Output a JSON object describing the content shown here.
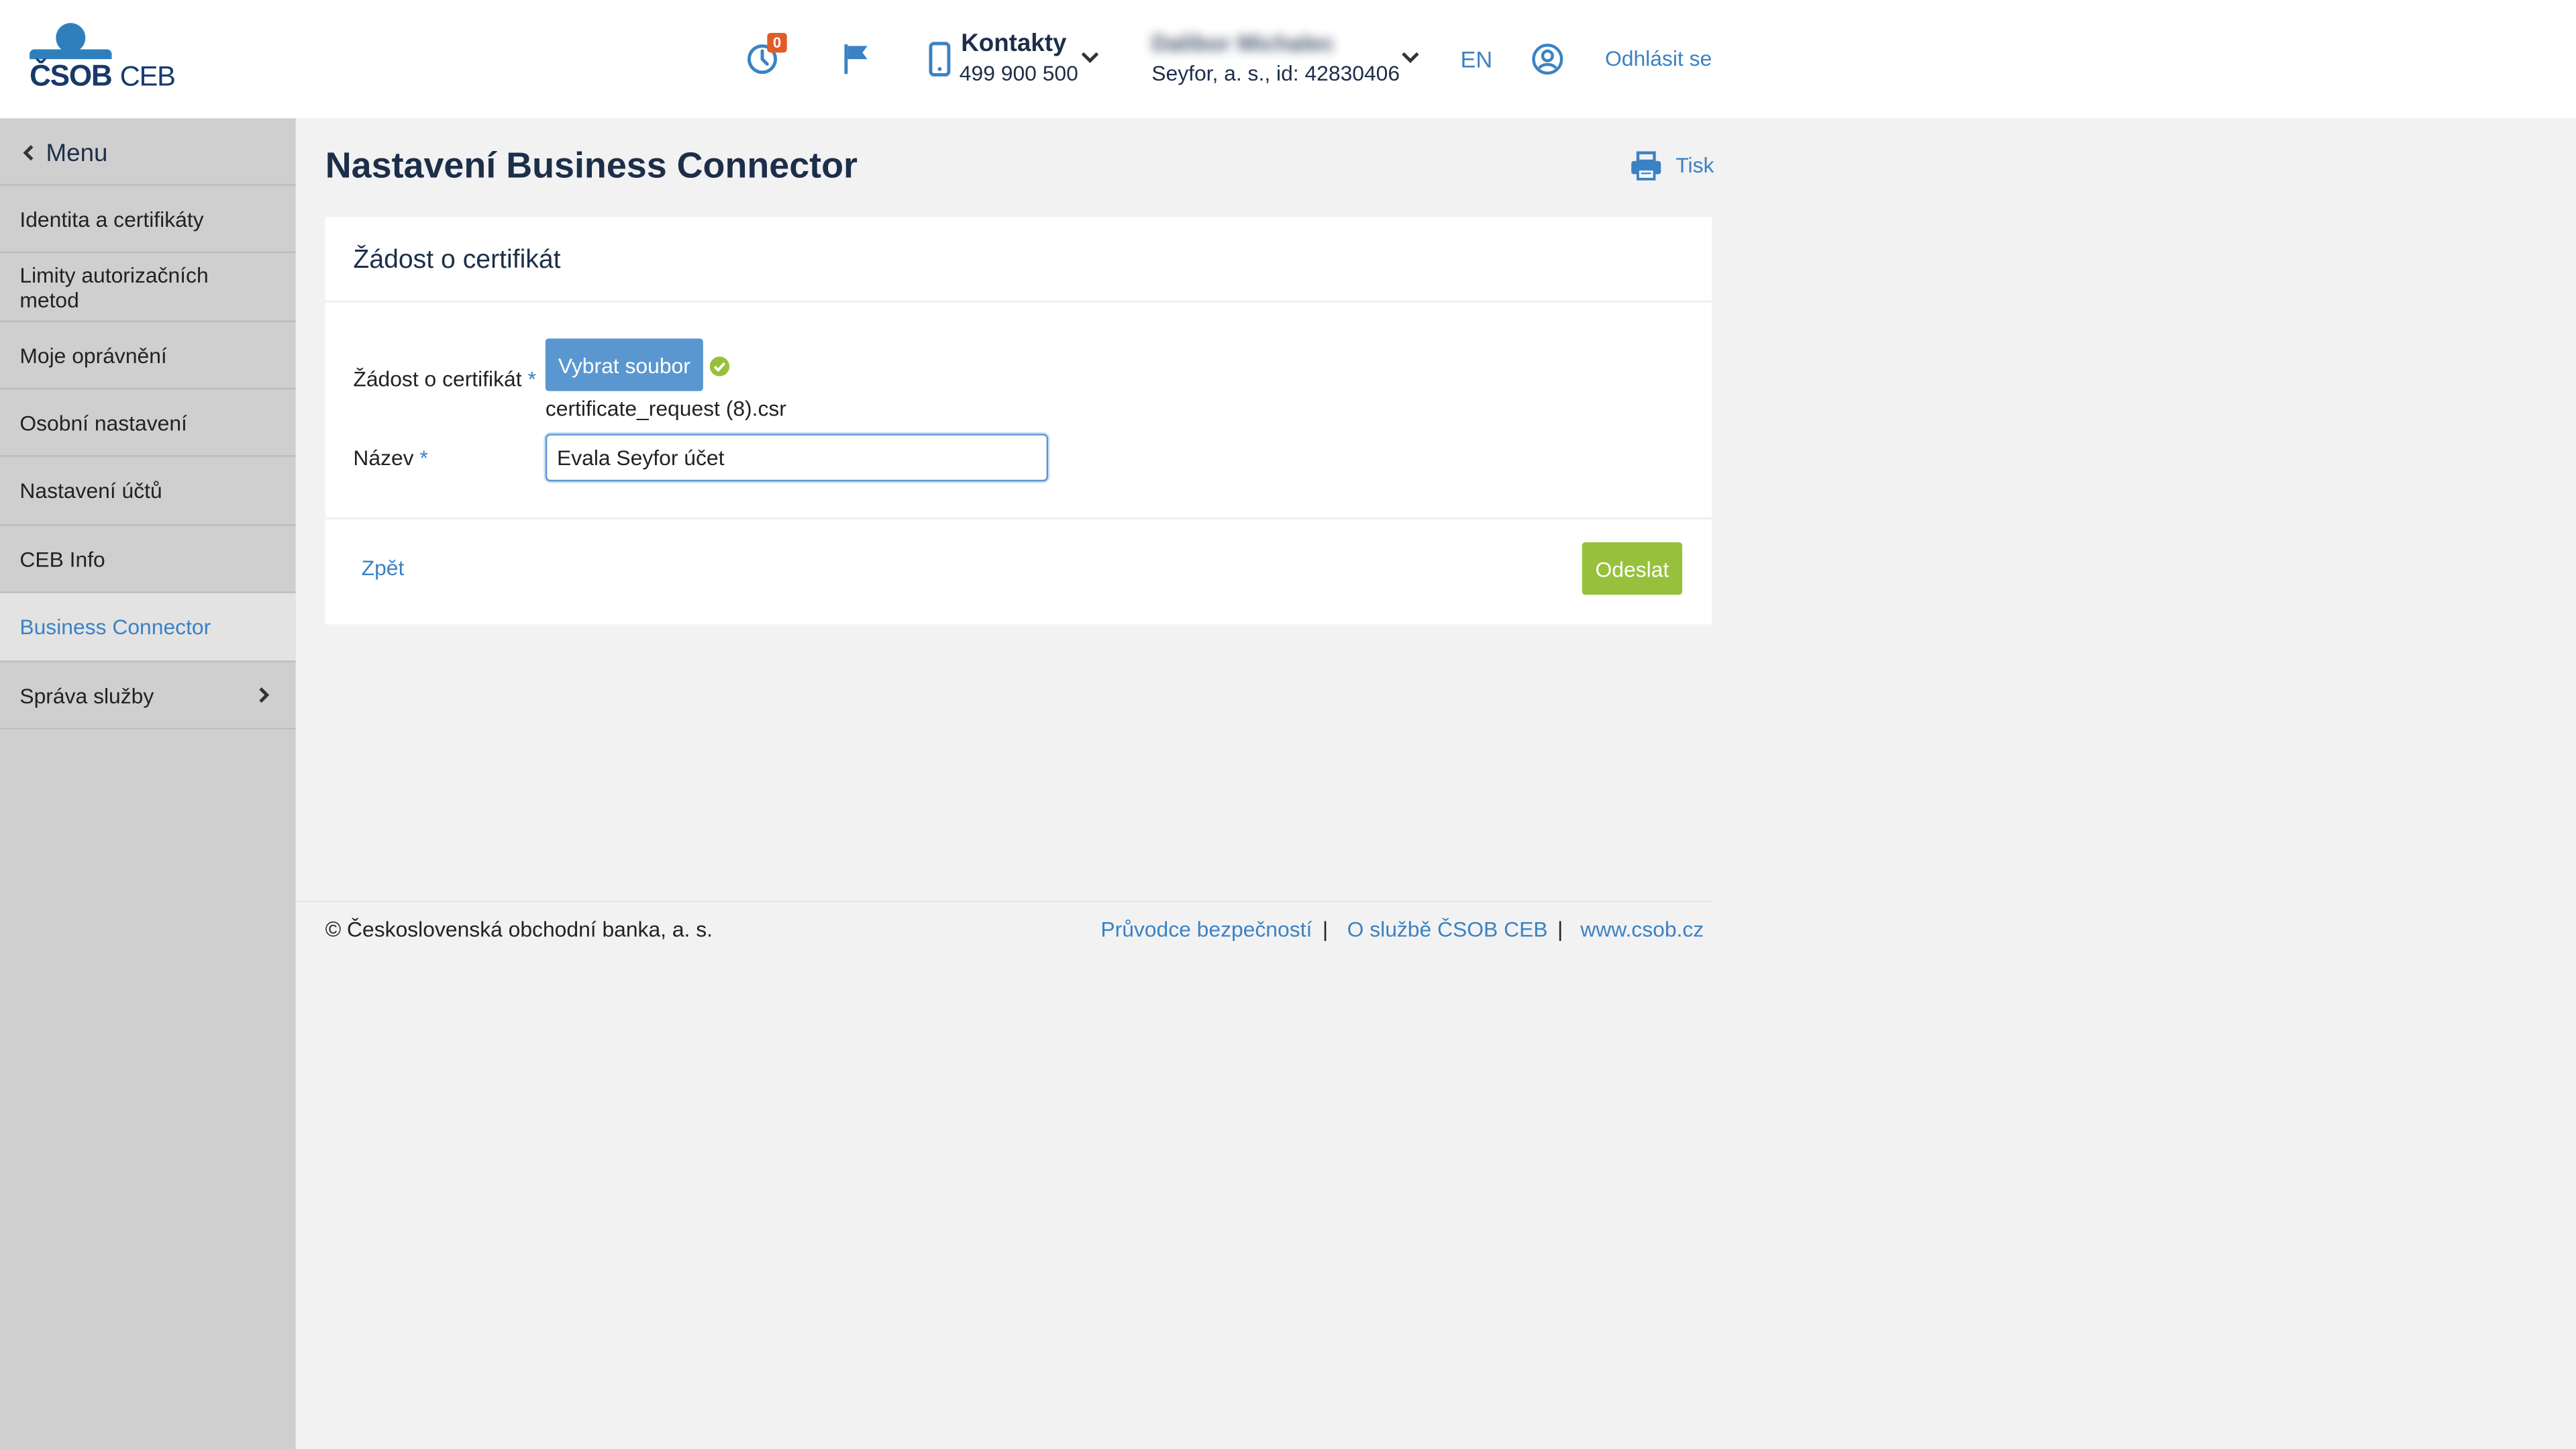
{
  "header": {
    "logo_text": "ČSOB",
    "logo_suffix": "CEB",
    "notification_count": "0",
    "contacts_title": "Kontakty",
    "contacts_phone": "499 900 500",
    "user_name": "Dalibor Michalec",
    "user_company": "Seyfor, a. s., id: 42830406",
    "language": "EN",
    "logout": "Odhlásit se"
  },
  "sidebar": {
    "menu_label": "Menu",
    "items": [
      {
        "label": "Identita a certifikáty"
      },
      {
        "label": "Limity autorizačních metod"
      },
      {
        "label": "Moje oprávnění"
      },
      {
        "label": "Osobní nastavení"
      },
      {
        "label": "Nastavení účtů"
      },
      {
        "label": "CEB Info"
      },
      {
        "label": "Business Connector",
        "active": true
      },
      {
        "label": "Správa služby"
      }
    ]
  },
  "main": {
    "title": "Nastavení Business Connector",
    "print_label": "Tisk",
    "card_title": "Žádost o certifikát",
    "form": {
      "file_label": "Žádost o certifikát",
      "required_mark": "*",
      "file_button": "Vybrat soubor",
      "file_name": "certificate_request (8).csr",
      "name_label": "Název",
      "name_value": "Evala Seyfor účet"
    },
    "back_label": "Zpět",
    "submit_label": "Odeslat"
  },
  "footer": {
    "copyright": "© Československá obchodní banka, a. s.",
    "links": [
      "Průvodce bezpečností",
      "O službě ČSOB CEB",
      "www.csob.cz"
    ],
    "separator": "|"
  },
  "colors": {
    "brand_blue": "#3b82c4",
    "button_blue": "#5a97d0",
    "submit_green": "#97c13c",
    "badge_orange": "#e05d2a",
    "title_navy": "#1d2e4a"
  },
  "icons": [
    "clock-icon",
    "flag-icon",
    "phone-icon",
    "chevron-down-icon",
    "user-circle-icon",
    "printer-icon",
    "check-circle-icon",
    "chevron-left-icon",
    "chevron-right-icon"
  ]
}
